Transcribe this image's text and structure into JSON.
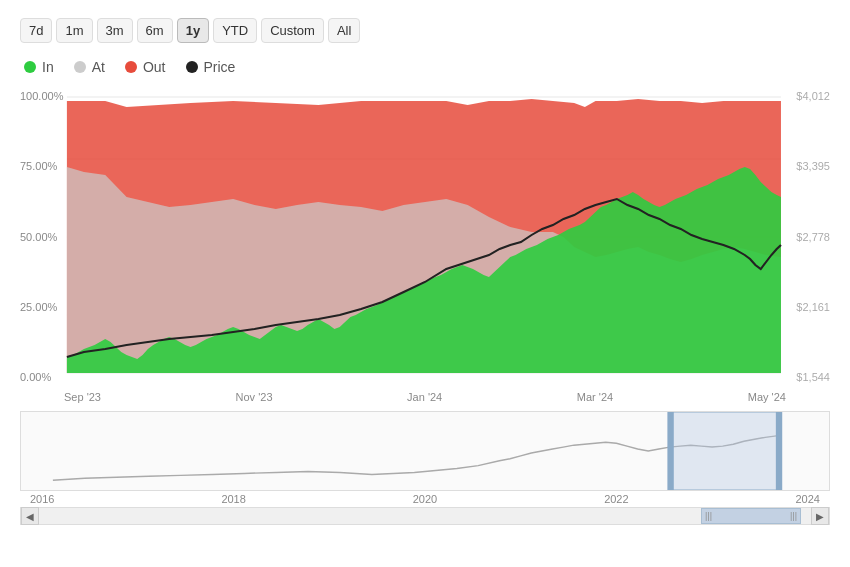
{
  "timeRange": {
    "buttons": [
      {
        "label": "7d",
        "active": false
      },
      {
        "label": "1m",
        "active": false
      },
      {
        "label": "3m",
        "active": false
      },
      {
        "label": "6m",
        "active": false
      },
      {
        "label": "1y",
        "active": true
      },
      {
        "label": "YTD",
        "active": false
      },
      {
        "label": "Custom",
        "active": false
      },
      {
        "label": "All",
        "active": false
      }
    ]
  },
  "legend": {
    "items": [
      {
        "label": "In",
        "dotClass": "dot-in"
      },
      {
        "label": "At",
        "dotClass": "dot-at"
      },
      {
        "label": "Out",
        "dotClass": "dot-out"
      },
      {
        "label": "Price",
        "dotClass": "dot-price"
      }
    ]
  },
  "mainChart": {
    "yAxisLeft": [
      "100.00%",
      "75.00%",
      "50.00%",
      "25.00%",
      "0.00%"
    ],
    "yAxisRight": [
      "$4,012",
      "$3,395",
      "$2,778",
      "$2,161",
      "$1,544"
    ],
    "xLabels": [
      "Sep '23",
      "Nov '23",
      "Jan '24",
      "Mar '24",
      "May '24"
    ]
  },
  "miniChart": {
    "xLabels": [
      "2016",
      "2018",
      "2020",
      "2022",
      "2024"
    ]
  },
  "scrollbar": {
    "leftArrow": "◀",
    "rightArrow": "▶",
    "handleLeft": "|||",
    "handleRight": "|||"
  }
}
